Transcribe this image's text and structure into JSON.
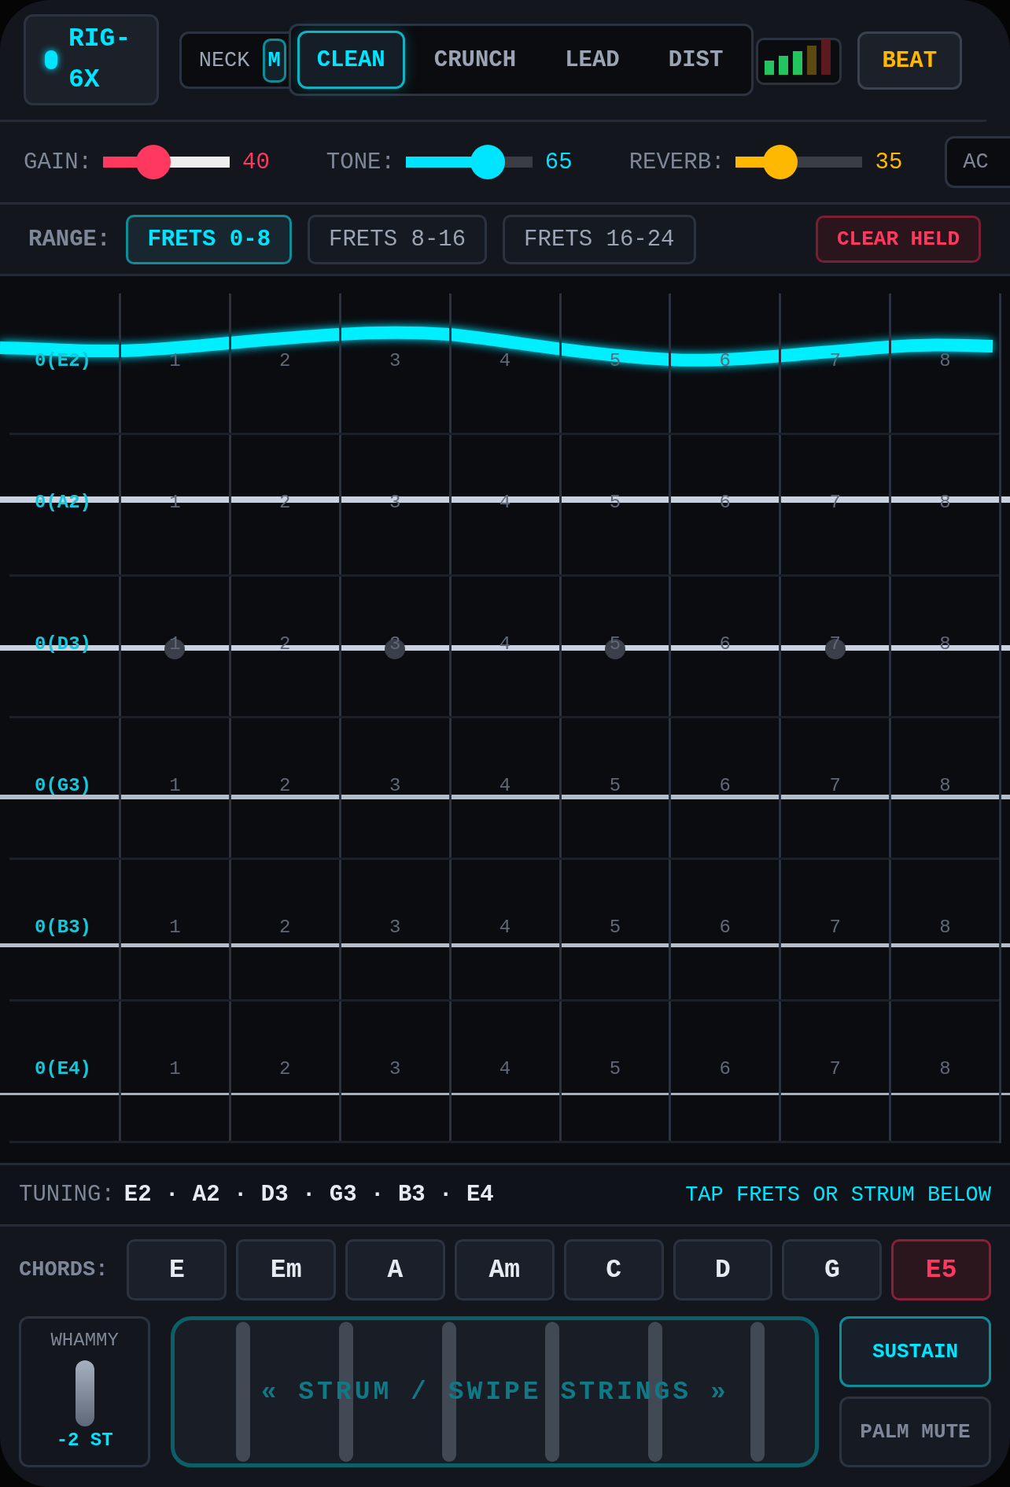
{
  "logo": {
    "text": "RIG-6X"
  },
  "pickups": [
    {
      "label": "NECK",
      "selected": false
    },
    {
      "label": "M",
      "selected": true
    }
  ],
  "tones": [
    {
      "label": "CLEAN",
      "selected": true
    },
    {
      "label": "CRUNCH",
      "selected": false
    },
    {
      "label": "LEAD",
      "selected": false
    },
    {
      "label": "DIST",
      "selected": false
    }
  ],
  "beat_button": {
    "label": "BEAT"
  },
  "sliders": [
    {
      "label": "GAIN:",
      "value": "40",
      "level": 0.4,
      "color": "#ff3860"
    },
    {
      "label": "TONE:",
      "value": "65",
      "level": 0.65,
      "color": "#00e5ff"
    },
    {
      "label": "REVERB:",
      "value": "35",
      "level": 0.35,
      "color": "#ffb800"
    }
  ],
  "ac_button": {
    "label": "AC"
  },
  "range": {
    "label": "RANGE:",
    "options": [
      {
        "label": "FRETS 0-8",
        "selected": true
      },
      {
        "label": "FRETS 8-16",
        "selected": false
      },
      {
        "label": "FRETS 16-24",
        "selected": false
      }
    ],
    "clear_button": "CLEAR HELD"
  },
  "strings": [
    {
      "label": "0(E2)",
      "vibrating": true,
      "frets": [
        {
          "label": "1",
          "inlay": false
        },
        {
          "label": "2",
          "inlay": false
        },
        {
          "label": "3",
          "inlay": false
        },
        {
          "label": "4",
          "inlay": false
        },
        {
          "label": "5",
          "inlay": false
        },
        {
          "label": "6",
          "inlay": false
        },
        {
          "label": "7",
          "inlay": false
        },
        {
          "label": "8",
          "inlay": false
        }
      ]
    },
    {
      "label": "0(A2)",
      "vibrating": false,
      "frets": [
        {
          "label": "1",
          "inlay": false
        },
        {
          "label": "2",
          "inlay": false
        },
        {
          "label": "3",
          "inlay": false
        },
        {
          "label": "4",
          "inlay": false
        },
        {
          "label": "5",
          "inlay": false
        },
        {
          "label": "6",
          "inlay": false
        },
        {
          "label": "7",
          "inlay": false
        },
        {
          "label": "8",
          "inlay": false
        }
      ]
    },
    {
      "label": "0(D3)",
      "vibrating": false,
      "frets": [
        {
          "label": "1",
          "inlay": true
        },
        {
          "label": "2",
          "inlay": false
        },
        {
          "label": "3",
          "inlay": true
        },
        {
          "label": "4",
          "inlay": false
        },
        {
          "label": "5",
          "inlay": true
        },
        {
          "label": "6",
          "inlay": false
        },
        {
          "label": "7",
          "inlay": true
        },
        {
          "label": "8",
          "inlay": false
        }
      ]
    },
    {
      "label": "0(G3)",
      "vibrating": false,
      "frets": [
        {
          "label": "1",
          "inlay": false
        },
        {
          "label": "2",
          "inlay": false
        },
        {
          "label": "3",
          "inlay": false
        },
        {
          "label": "4",
          "inlay": false
        },
        {
          "label": "5",
          "inlay": false
        },
        {
          "label": "6",
          "inlay": false
        },
        {
          "label": "7",
          "inlay": false
        },
        {
          "label": "8",
          "inlay": false
        }
      ]
    },
    {
      "label": "0(B3)",
      "vibrating": false,
      "frets": [
        {
          "label": "1",
          "inlay": false
        },
        {
          "label": "2",
          "inlay": false
        },
        {
          "label": "3",
          "inlay": false
        },
        {
          "label": "4",
          "inlay": false
        },
        {
          "label": "5",
          "inlay": false
        },
        {
          "label": "6",
          "inlay": false
        },
        {
          "label": "7",
          "inlay": false
        },
        {
          "label": "8",
          "inlay": false
        }
      ]
    },
    {
      "label": "0(E4)",
      "vibrating": false,
      "frets": [
        {
          "label": "1",
          "inlay": false
        },
        {
          "label": "2",
          "inlay": false
        },
        {
          "label": "3",
          "inlay": false
        },
        {
          "label": "4",
          "inlay": false
        },
        {
          "label": "5",
          "inlay": false
        },
        {
          "label": "6",
          "inlay": false
        },
        {
          "label": "7",
          "inlay": false
        },
        {
          "label": "8",
          "inlay": false
        }
      ]
    }
  ],
  "tuning": {
    "label": "TUNING:",
    "notes": "E2 · A2 · D3 · G3 · B3 · E4",
    "hint": "TAP FRETS OR STRUM BELOW"
  },
  "chords": {
    "label": "CHORDS:",
    "items": [
      {
        "label": "E",
        "selected": false
      },
      {
        "label": "Em",
        "selected": false
      },
      {
        "label": "A",
        "selected": false
      },
      {
        "label": "Am",
        "selected": false
      },
      {
        "label": "C",
        "selected": false
      },
      {
        "label": "D",
        "selected": false
      },
      {
        "label": "G",
        "selected": false
      },
      {
        "label": "E5",
        "selected": true
      }
    ]
  },
  "whammy": {
    "label": "WHAMMY",
    "value": "-2 ST"
  },
  "strum_pad": {
    "text": "« STRUM / SWIPE STRINGS »"
  },
  "toggles": [
    {
      "label": "SUSTAIN",
      "on": true
    },
    {
      "label": "PALM MUTE",
      "on": false
    }
  ]
}
